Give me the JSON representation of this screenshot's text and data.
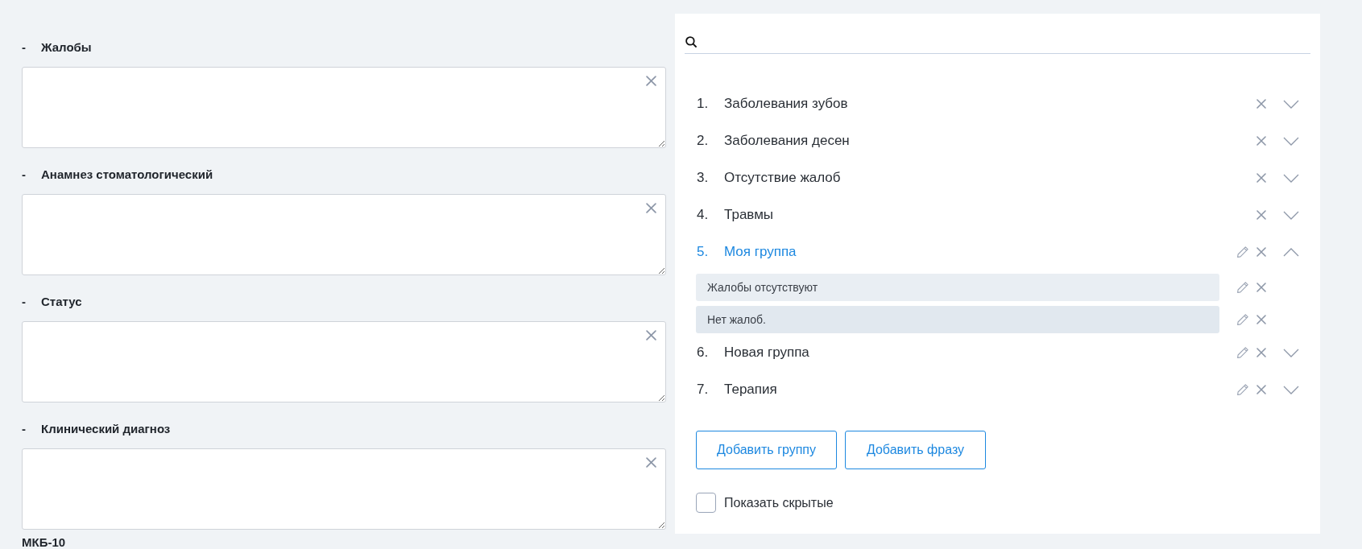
{
  "form": {
    "sections": [
      {
        "marker": "-",
        "title": "Жалобы"
      },
      {
        "marker": "-",
        "title": "Анамнез стоматологический"
      },
      {
        "marker": "-",
        "title": "Статус"
      },
      {
        "marker": "-",
        "title": "Клинический диагноз"
      }
    ],
    "footer_label": "МКБ-10"
  },
  "phrase_panel": {
    "groups": [
      {
        "number": "1.",
        "name": "Заболевания зубов",
        "editable": false,
        "expanded": false
      },
      {
        "number": "2.",
        "name": "Заболевания десен",
        "editable": false,
        "expanded": false
      },
      {
        "number": "3.",
        "name": "Отсутствие жалоб",
        "editable": false,
        "expanded": false
      },
      {
        "number": "4.",
        "name": "Травмы",
        "editable": false,
        "expanded": false
      },
      {
        "number": "5.",
        "name": "Моя группа",
        "editable": true,
        "expanded": true,
        "phrases": [
          {
            "text": "Жалобы отсутствуют",
            "selected": false
          },
          {
            "text": "Нет жалоб.",
            "selected": true
          }
        ]
      },
      {
        "number": "6.",
        "name": "Новая группа",
        "editable": true,
        "expanded": false
      },
      {
        "number": "7.",
        "name": "Терапия",
        "editable": true,
        "expanded": false
      }
    ],
    "buttons": [
      {
        "label": "Добавить группу"
      },
      {
        "label": "Добавить фразу"
      }
    ],
    "show_hidden": {
      "label": "Показать скрытые",
      "checked": false
    }
  }
}
